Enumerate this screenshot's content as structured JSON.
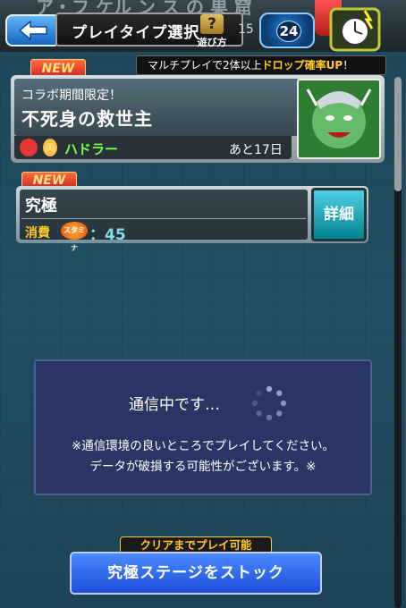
{
  "topbar": {
    "ghost_title": "ア・フ ケル ン ス の 巣 窟",
    "back_label": "",
    "title": "プレイタイプ選択",
    "help_label": "遊び方",
    "count_ghost": "15",
    "stamina_badge": "24"
  },
  "multi_note": {
    "prefix": "マルチプレイで2体以上",
    "highlight": "ドロップ確率UP",
    "suffix": "！"
  },
  "event": {
    "new_label": "NEW",
    "subtitle": "コラボ期間限定！",
    "title": "不死身の救世主",
    "boss_name": "ハドラー",
    "days_left": "あと17日"
  },
  "quest": {
    "new_label": "NEW",
    "name": "究極",
    "cost_label": "消費",
    "stamina_icon_text": "スタミナ",
    "cost_value": "：45",
    "detail_label": "詳細"
  },
  "dialog": {
    "connecting": "通信中です…",
    "note_line1": "※通信環境の良いところでプレイしてください。",
    "note_line2": "データが破損する可能性がございます。※"
  },
  "bottom": {
    "clear_tag": "クリアまでプレイ可能",
    "stock_button": "究極ステージをストック"
  },
  "colors": {
    "accent_blue": "#1e4ed8",
    "highlight_yellow": "#ffca28",
    "boss_green": "#7cfc4c"
  }
}
